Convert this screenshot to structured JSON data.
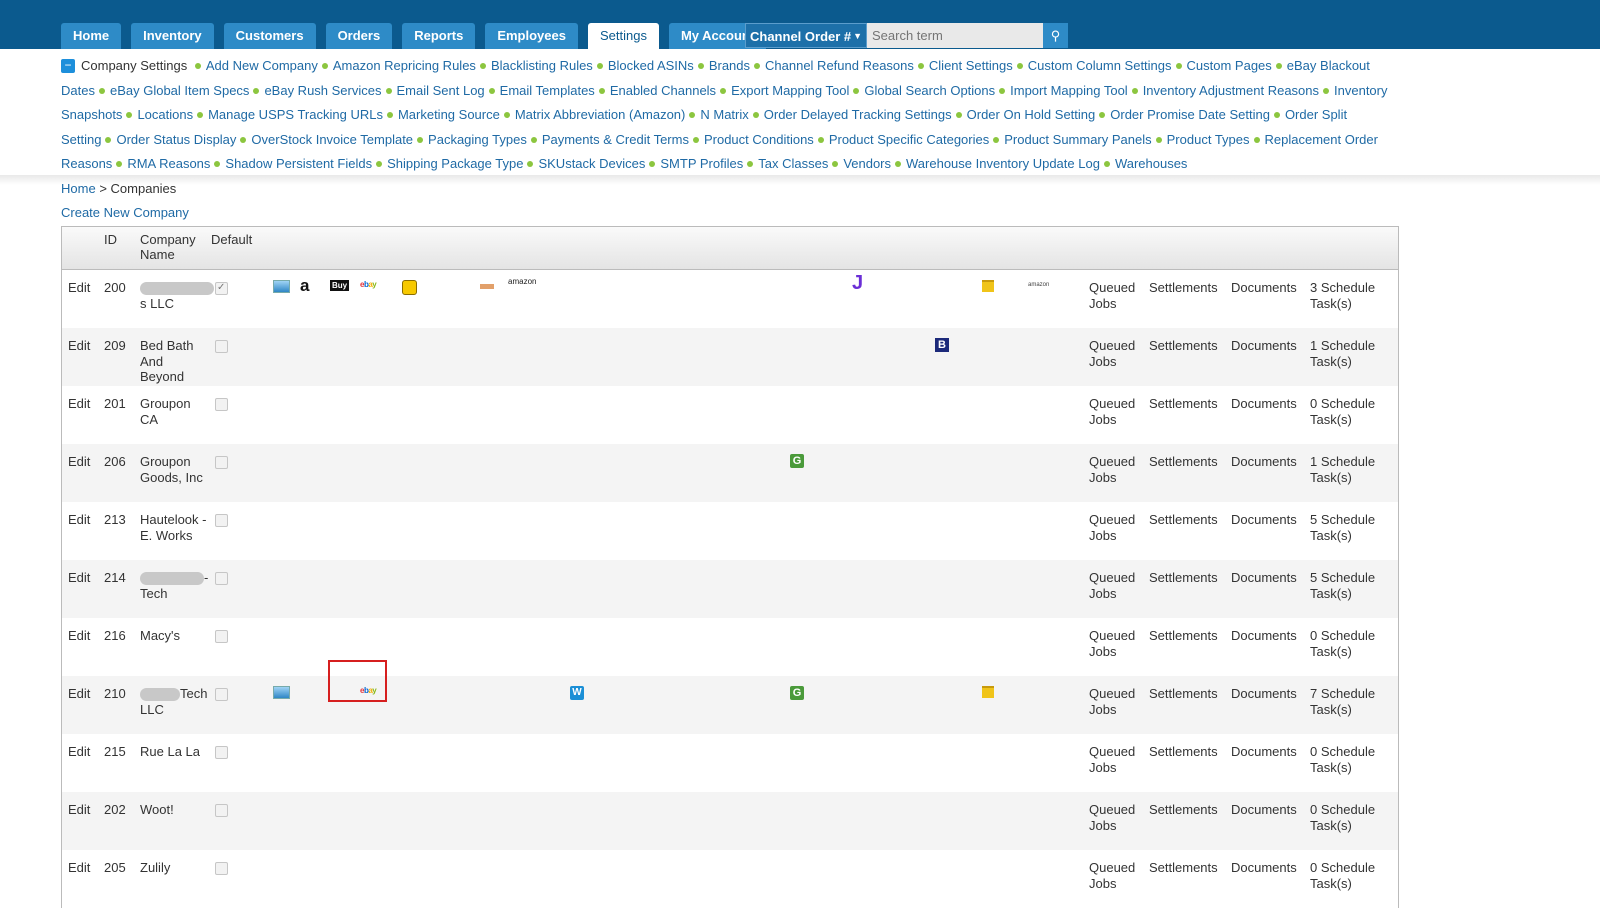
{
  "nav": {
    "tabs": [
      "Home",
      "Inventory",
      "Customers",
      "Orders",
      "Reports",
      "Employees",
      "Settings",
      "My Account"
    ],
    "active_tab": "Settings",
    "channel_select": "Channel Order #",
    "search_placeholder": "Search term"
  },
  "settings": {
    "current": "Company Settings",
    "links": [
      "Add New Company",
      "Amazon Repricing Rules",
      "Blacklisting Rules",
      "Blocked ASINs",
      "Brands",
      "Channel Refund Reasons",
      "Client Settings",
      "Custom Column Settings",
      "Custom Pages",
      "eBay Blackout Dates",
      "eBay Global Item Specs",
      "eBay Rush Services",
      "Email Sent Log",
      "Email Templates",
      "Enabled Channels",
      "Export Mapping Tool",
      "Global Search Options",
      "Import Mapping Tool",
      "Inventory Adjustment Reasons",
      "Inventory Snapshots",
      "Locations",
      "Manage USPS Tracking URLs",
      "Marketing Source",
      "Matrix Abbreviation (Amazon)",
      "N Matrix",
      "Order Delayed Tracking Settings",
      "Order On Hold Setting",
      "Order Promise Date Setting",
      "Order Split Setting",
      "Order Status Display",
      "OverStock Invoice Template",
      "Packaging Types",
      "Payments & Credit Terms",
      "Product Conditions",
      "Product Specific Categories",
      "Product Summary Panels",
      "Product Types",
      "Replacement Order Reasons",
      "RMA Reasons",
      "Shadow Persistent Fields",
      "Shipping Package Type",
      "SKUstack Devices",
      "SMTP Profiles",
      "Tax Classes",
      "Vendors",
      "Warehouse Inventory Update Log",
      "Warehouses"
    ]
  },
  "breadcrumb": {
    "home": "Home",
    "sep": ">",
    "current": "Companies"
  },
  "create_link": "Create New Company",
  "table": {
    "headers": {
      "id": "ID",
      "name": "Company Name",
      "default": "Default"
    },
    "action_labels": {
      "edit": "Edit",
      "queued": "Queued Jobs",
      "settlements": "Settlements",
      "documents": "Documents",
      "tasks_suffix": "Schedule Task(s)"
    },
    "rows": [
      {
        "id": "200",
        "name": "s LLC",
        "default": true,
        "tasks": "3"
      },
      {
        "id": "209",
        "name": "Bed Bath And Beyond",
        "default": false,
        "tasks": "1"
      },
      {
        "id": "201",
        "name": "Groupon CA",
        "default": false,
        "tasks": "0"
      },
      {
        "id": "206",
        "name": "Groupon Goods, Inc",
        "default": false,
        "tasks": "1"
      },
      {
        "id": "213",
        "name": "Hautelook - E. Works",
        "default": false,
        "tasks": "5"
      },
      {
        "id": "214",
        "name": "- Tech",
        "default": false,
        "tasks": "5"
      },
      {
        "id": "216",
        "name": "Macy's",
        "default": false,
        "tasks": "0"
      },
      {
        "id": "210",
        "name": "Tech LLC",
        "default": false,
        "tasks": "7"
      },
      {
        "id": "215",
        "name": "Rue La La",
        "default": false,
        "tasks": "0"
      },
      {
        "id": "202",
        "name": "Woot!",
        "default": false,
        "tasks": "0"
      },
      {
        "id": "205",
        "name": "Zulily",
        "default": false,
        "tasks": "0"
      }
    ]
  },
  "icons": {
    "amazon_text": "amazon",
    "buy_text": "Buy",
    "j_text": "J",
    "b_text": "B",
    "g_text": "G",
    "w_text": "W"
  }
}
